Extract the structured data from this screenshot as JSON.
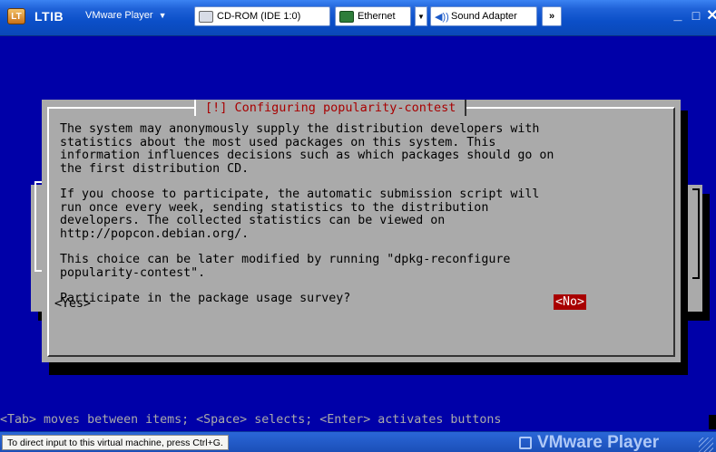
{
  "titlebar": {
    "app_icon_text": "LT",
    "vm_name": "LTIB",
    "player_menu": "VMware Player",
    "devices": {
      "cdrom": "CD-ROM (IDE 1:0)",
      "ethernet": "Ethernet",
      "sound": "Sound Adapter",
      "more": "»"
    },
    "minimize": "_",
    "maximize": "□",
    "close": "✕"
  },
  "dialog": {
    "title": "[!] Configuring popularity-contest",
    "paragraphs": [
      "The system may anonymously supply the distribution developers with\nstatistics about the most used packages on this system. This\ninformation influences decisions such as which packages should go on\nthe first distribution CD.",
      "If you choose to participate, the automatic submission script will\nrun once every week, sending statistics to the distribution\ndevelopers. The collected statistics can be viewed on\nhttp://popcon.debian.org/.",
      "This choice can be later modified by running \"dpkg-reconfigure\npopularity-contest\"."
    ],
    "question": "Participate in the package usage survey?",
    "yes_label": "<Yes>",
    "no_label": "<No>"
  },
  "help_line": "<Tab> moves between items; <Space> selects; <Enter> activates buttons",
  "statusbar": {
    "hint": "To direct input to this virtual machine, press Ctrl+G.",
    "brand": "VMware Player"
  },
  "colors": {
    "console_bg": "#0000a8",
    "dialog_bg": "#aaaaaa",
    "title_red": "#a80000",
    "titlebar_blue": "#1f62d8"
  }
}
